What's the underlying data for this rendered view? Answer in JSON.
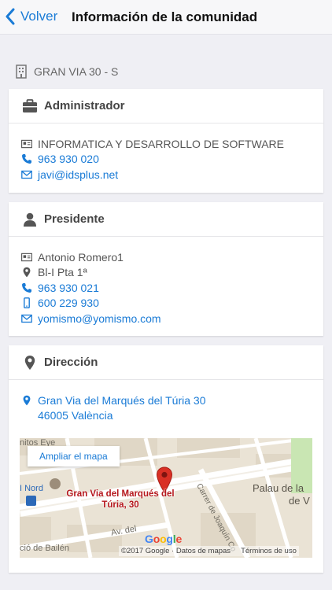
{
  "navbar": {
    "back_label": "Volver",
    "title": "Información de la comunidad"
  },
  "community": {
    "name": "GRAN VIA 30 - S"
  },
  "administrator": {
    "header": "Administrador",
    "company": "INFORMATICA Y DESARROLLO DE SOFTWARE",
    "phone": "963 930 020",
    "email": "javi@idsplus.net"
  },
  "president": {
    "header": "Presidente",
    "name": "Antonio Romero1",
    "location": "Bl-I Pta 1ª",
    "phone": "963 930 021",
    "mobile": "600 229 930",
    "email": "yomismo@yomismo.com"
  },
  "address": {
    "header": "Dirección",
    "line1": "Gran Via del Marqués del Túria 30",
    "line2": "46005 València"
  },
  "map": {
    "expand_label": "Ampliar el mapa",
    "place_label": "Gran Via del Marqués del Túria, 30",
    "copyright": "©2017 Google",
    "map_data": "Datos de mapas",
    "terms": "Términos de uso",
    "labels": [
      "Palau de la",
      "de V",
      "Carrer de Joaquín Co",
      "Av. del",
      "ció de Bailén",
      "I Nord",
      "nitos Eye"
    ]
  },
  "colors": {
    "accent": "#1a7bd6",
    "pin": "#d93025",
    "place_label": "#b5171d"
  }
}
